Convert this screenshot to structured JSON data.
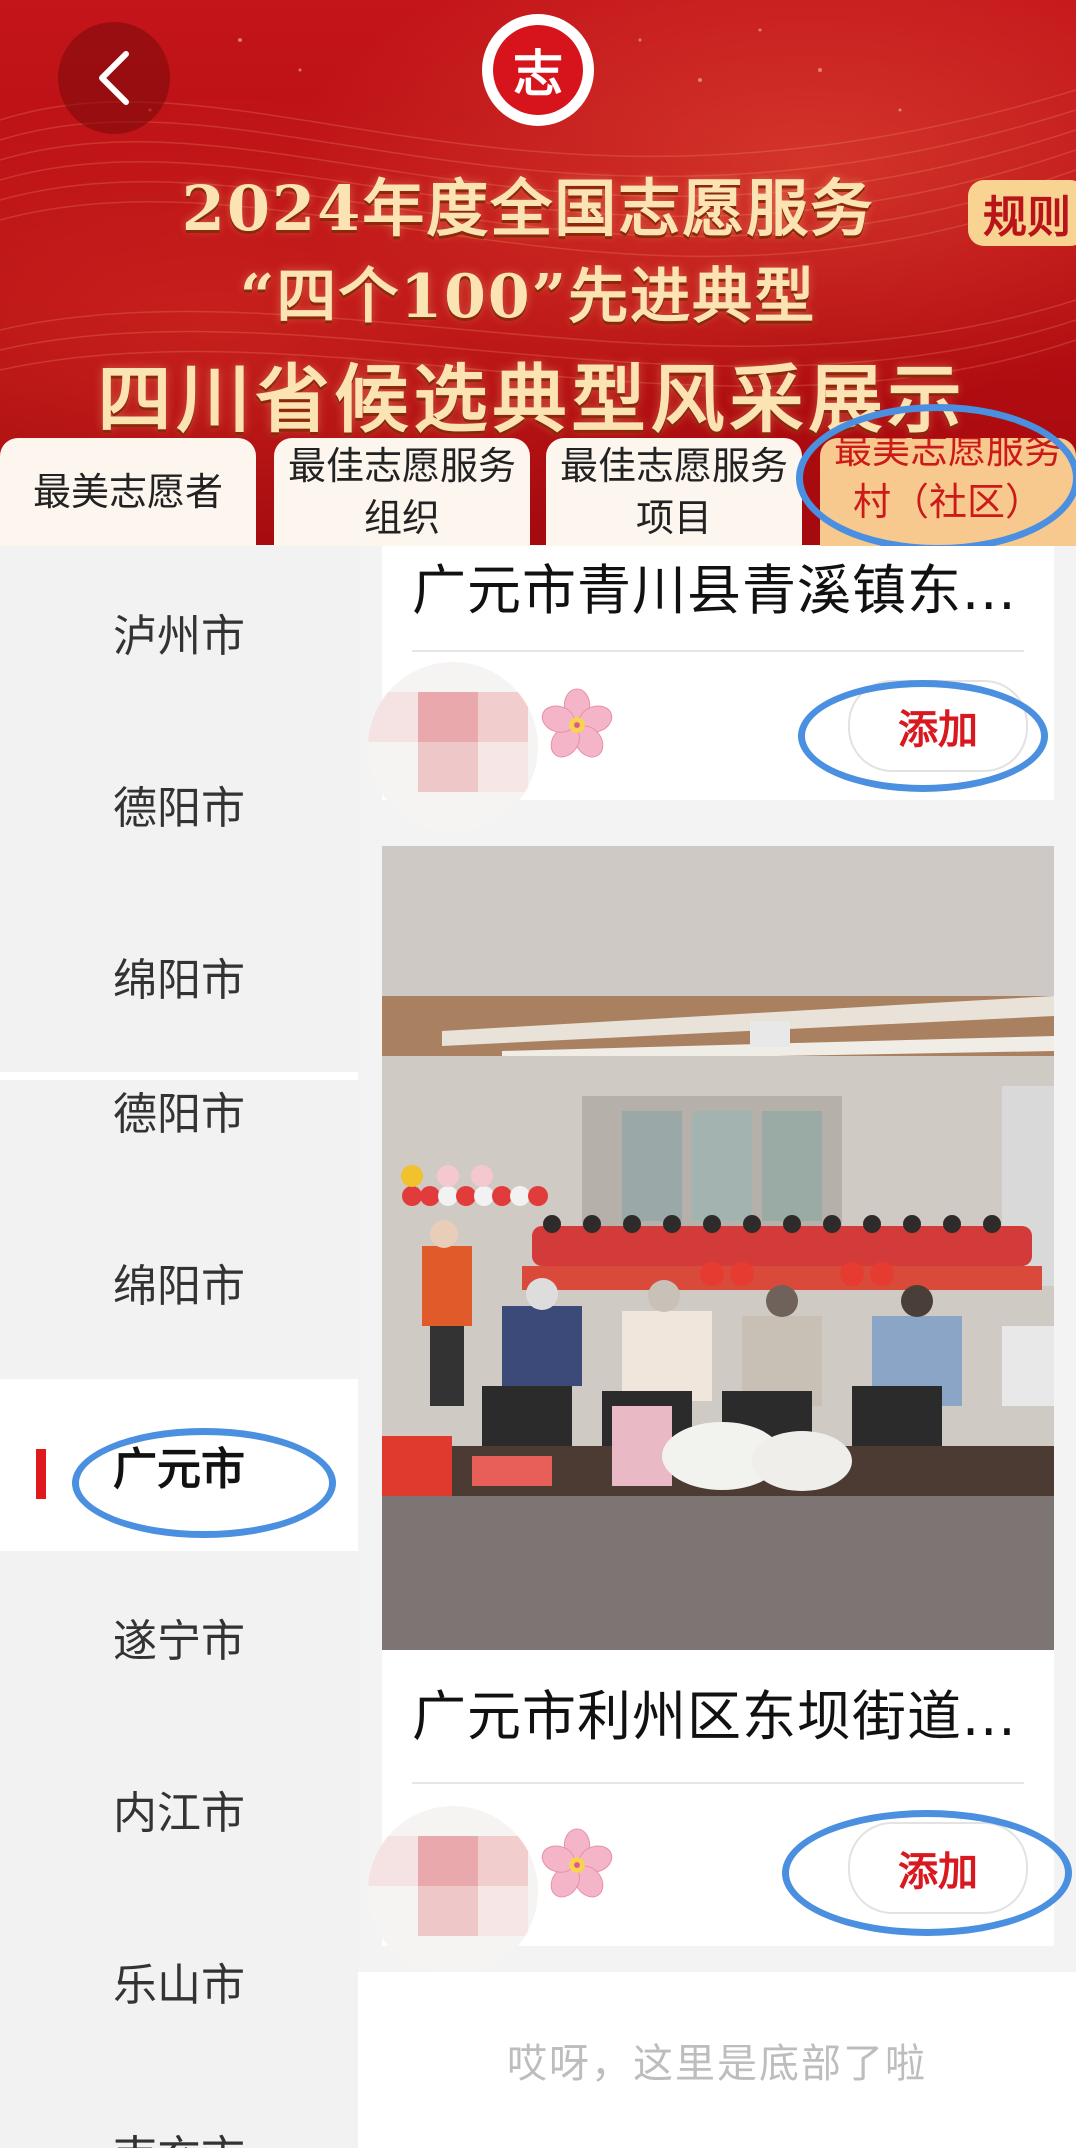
{
  "banner": {
    "title_line1": "2024年度全国志愿服务",
    "title_line2": "“四个100”先进典型",
    "title_line3": "四川省候选典型风采展示",
    "logo_char": "志",
    "rules_label": "规则"
  },
  "tabs": [
    {
      "label": "最美志愿者"
    },
    {
      "label": "最佳志愿服务组织"
    },
    {
      "label": "最佳志愿服务项目"
    },
    {
      "label": "最美志愿服务村（社区）"
    }
  ],
  "cities": [
    {
      "label": "泸州市"
    },
    {
      "label": "德阳市"
    },
    {
      "label": "绵阳市"
    },
    {
      "label": "德阳市"
    },
    {
      "label": "绵阳市"
    },
    {
      "label": "广元市",
      "active": true
    },
    {
      "label": "遂宁市"
    },
    {
      "label": "内江市"
    },
    {
      "label": "乐山市"
    },
    {
      "label": "南充市"
    }
  ],
  "cards": [
    {
      "title": "广元市青川县青溪镇东...",
      "add_label": "添加"
    },
    {
      "title": "广元市利州区东坝街道...",
      "add_label": "添加"
    }
  ],
  "footer_tip": "哎呀，这里是底部了啦",
  "colors": {
    "accent": "#d81920",
    "banner_red": "#b50d12",
    "active_tab": "#f7c98e"
  }
}
